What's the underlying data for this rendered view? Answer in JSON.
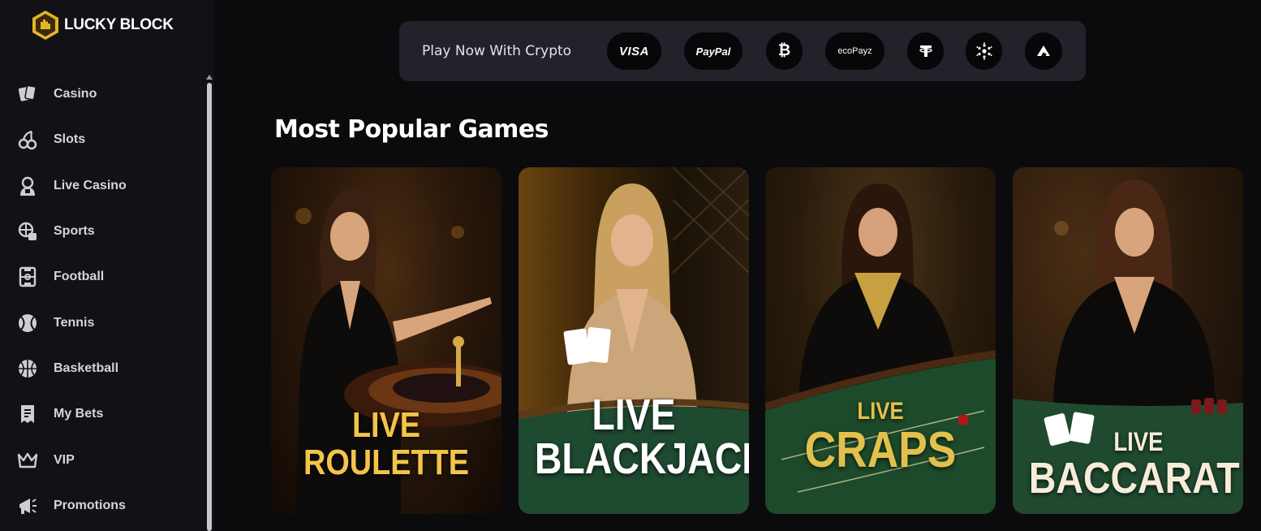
{
  "brand": {
    "name": "LUCKY BLOCK"
  },
  "sidebar": {
    "items": [
      {
        "label": "Casino",
        "icon": "cards-icon"
      },
      {
        "label": "Slots",
        "icon": "cherries-icon"
      },
      {
        "label": "Live Casino",
        "icon": "dealer-icon"
      },
      {
        "label": "Sports",
        "icon": "sports-icon"
      },
      {
        "label": "Football",
        "icon": "football-field-icon"
      },
      {
        "label": "Tennis",
        "icon": "tennis-ball-icon"
      },
      {
        "label": "Basketball",
        "icon": "basketball-icon"
      },
      {
        "label": "My Bets",
        "icon": "bet-slip-icon"
      },
      {
        "label": "VIP",
        "icon": "crown-icon"
      },
      {
        "label": "Promotions",
        "icon": "megaphone-icon"
      }
    ]
  },
  "payments": {
    "label": "Play Now With Crypto",
    "methods": [
      {
        "label": "VISA",
        "icon": "visa-icon"
      },
      {
        "label": "PayPal",
        "icon": "paypal-icon"
      },
      {
        "label": "",
        "icon": "bitcoin-icon"
      },
      {
        "label": "ecoPayz",
        "icon": "ecopayz-icon"
      },
      {
        "label": "",
        "icon": "tether-icon"
      },
      {
        "label": "",
        "icon": "cardano-icon"
      },
      {
        "label": "",
        "icon": "avalanche-icon"
      }
    ]
  },
  "main": {
    "title": "Most Popular Games",
    "games": [
      {
        "line1": "LIVE",
        "line2": "ROULETTE",
        "color": "#f2c44a"
      },
      {
        "line1": "LIVE",
        "line2": "BLACKJACK",
        "color": "#ffffff"
      },
      {
        "line1": "LIVE",
        "line2": "CRAPS",
        "color": "#e2c04c"
      },
      {
        "line1": "LIVE",
        "line2": "BACCARAT",
        "color": "#f6ecd8"
      }
    ]
  },
  "colors": {
    "background": "#0b0a0c",
    "sidebar": "#121115",
    "paybar": "#232129",
    "gold": "#e6b325"
  }
}
